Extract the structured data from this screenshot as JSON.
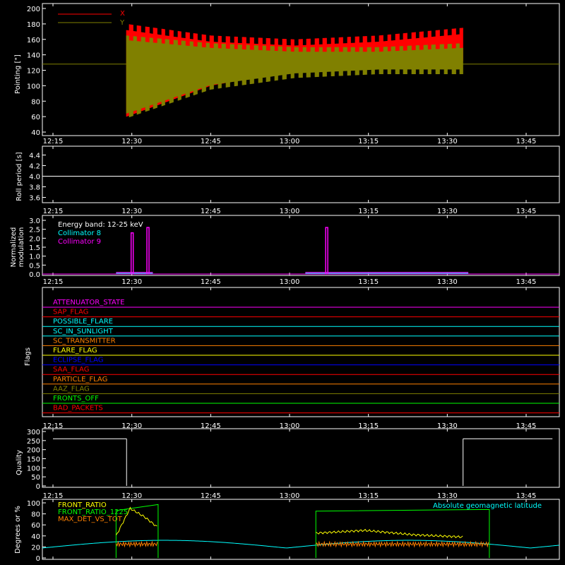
{
  "time_ticks": [
    "12:15",
    "12:30",
    "12:45",
    "13:00",
    "13:15",
    "13:30",
    "13:45"
  ],
  "colors": {
    "background": "#000000",
    "axes": "#ffffff",
    "x": "#ff0000",
    "y": "#808000",
    "cyan": "#00ffff",
    "magenta": "#ff00ff",
    "green": "#00ff00",
    "yellow": "#ffff00",
    "orange": "#ff8000",
    "blue": "#0000ff",
    "red": "#ff0000"
  },
  "chart_data": [
    {
      "type": "line",
      "panel": "pointing",
      "ylabel": "Pointing [\"]",
      "ylim": [
        40,
        200
      ],
      "yticks": [
        "40",
        "60",
        "80",
        "100",
        "120",
        "140",
        "160",
        "180",
        "200"
      ],
      "legend": [
        "X",
        "Y"
      ],
      "series": [
        {
          "name": "X",
          "description": "oscillating envelope",
          "x_range": [
            "12:29",
            "13:33"
          ],
          "envelope_low": [
            60,
            100,
            120,
            128,
            128
          ],
          "envelope_high": [
            180,
            165,
            160,
            165,
            175
          ]
        },
        {
          "name": "Y",
          "description": "oscillating envelope",
          "x_range": [
            "12:29",
            "13:33"
          ],
          "envelope_low": [
            58,
            95,
            110,
            115,
            115
          ],
          "envelope_high": [
            165,
            155,
            150,
            150,
            155
          ]
        }
      ],
      "baseline": 128
    },
    {
      "type": "line",
      "panel": "roll",
      "ylabel": "Roll period [s]",
      "ylim": [
        3.5,
        4.5
      ],
      "yticks": [
        "3.6",
        "3.8",
        "4.0",
        "4.2",
        "4.4"
      ],
      "value": 4.0
    },
    {
      "type": "line",
      "panel": "modulation",
      "ylabel": "Normalized modulation",
      "ylim": [
        0,
        3.0
      ],
      "yticks": [
        "0.0",
        "0.5",
        "1.0",
        "1.5",
        "2.0",
        "2.5",
        "3.0"
      ],
      "annotation": "Energy band: 12-25 keV",
      "legend": [
        "Collimator 8",
        "Collimator 9"
      ],
      "spikes": [
        [
          "12:30",
          2.3
        ],
        [
          "12:33",
          2.6
        ],
        [
          "13:07",
          2.6
        ]
      ],
      "segments": [
        [
          "12:27",
          "12:34"
        ],
        [
          "13:03",
          "13:34"
        ]
      ]
    },
    {
      "type": "table",
      "panel": "flags",
      "ylabel": "Flags",
      "flags": [
        {
          "name": "ATTENUATOR_STATE",
          "color": "#ff00ff"
        },
        {
          "name": "SAP_FLAG",
          "color": "#ff0000"
        },
        {
          "name": "POSSIBLE_FLARE",
          "color": "#00ffff"
        },
        {
          "name": "SC_IN_SUNLIGHT",
          "color": "#00ffff"
        },
        {
          "name": "SC_TRANSMITTER",
          "color": "#ff8000"
        },
        {
          "name": "FLARE_FLAG",
          "color": "#ffff00"
        },
        {
          "name": "ECLIPSE_FLAG",
          "color": "#0000ff"
        },
        {
          "name": "SAA_FLAG",
          "color": "#ff0000"
        },
        {
          "name": "PARTICLE_FLAG",
          "color": "#ff8000"
        },
        {
          "name": "AAZ_FLAG",
          "color": "#808000"
        },
        {
          "name": "FRONTS_OFF",
          "color": "#00ff00"
        },
        {
          "name": "BAD_PACKETS",
          "color": "#ff0000"
        }
      ]
    },
    {
      "type": "line",
      "panel": "quality",
      "ylabel": "Quality",
      "ylim": [
        0,
        300
      ],
      "yticks": [
        "0",
        "50",
        "100",
        "150",
        "200",
        "250",
        "300"
      ],
      "segments": [
        [
          "12:15",
          "12:29",
          260
        ],
        [
          "13:33",
          "13:50",
          260
        ]
      ]
    },
    {
      "type": "line",
      "panel": "ratio",
      "ylabel": "Degrees or %",
      "ylim": [
        0,
        100
      ],
      "yticks": [
        "0",
        "20",
        "40",
        "60",
        "80",
        "100"
      ],
      "legend": [
        "FRONT_RATIO",
        "FRONT_RATIO_1225",
        "MAX_DET_VS_TOT"
      ],
      "right_legend": "Absolute geomagnetic latitude"
    }
  ]
}
